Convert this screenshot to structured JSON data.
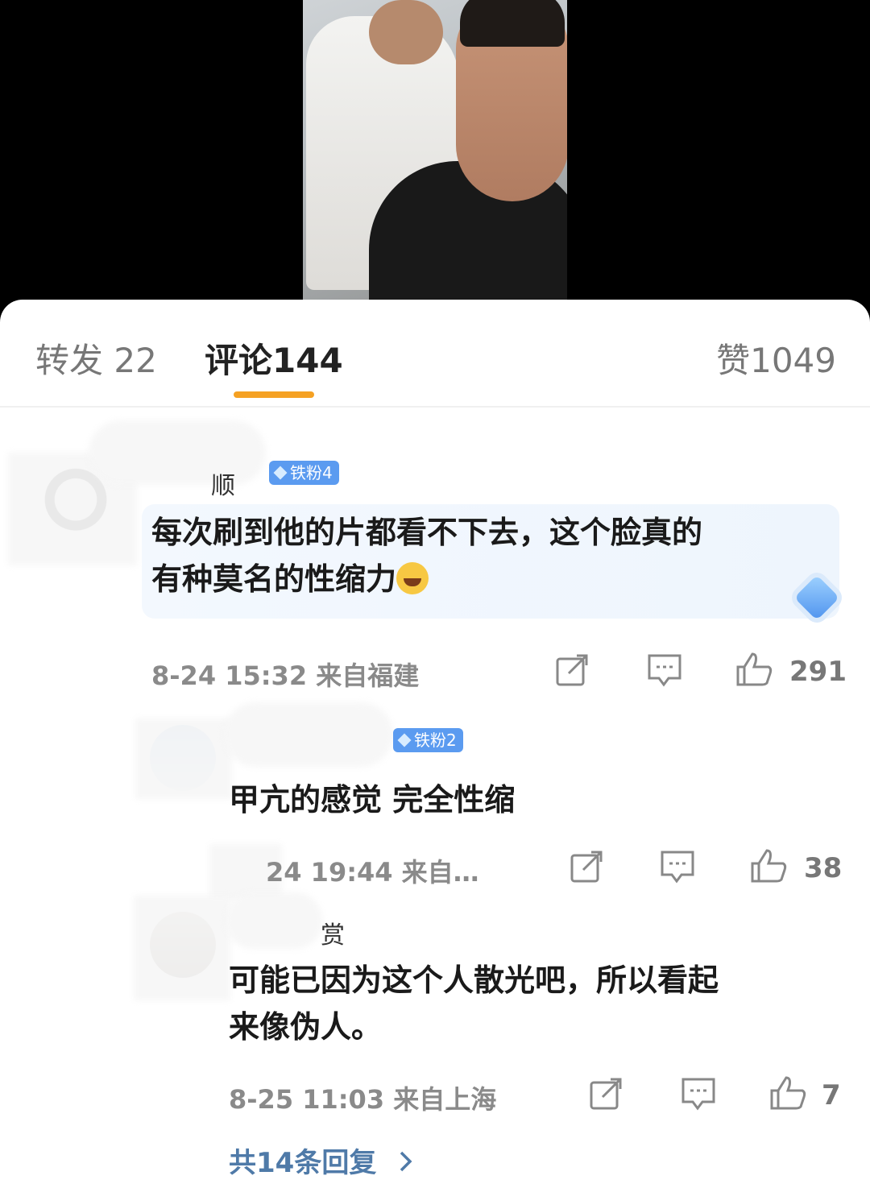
{
  "tabs": {
    "repost": "转发 22",
    "comments": "评论144",
    "likes": "赞1049"
  },
  "comment": {
    "badge": "铁粉4",
    "username_partial": "顺",
    "text_line1": "每次刷到他的片都看不下去，这个脸真的",
    "text_line2": "有种莫名的性缩力",
    "time": "8-24 15:32",
    "location": "来自福建",
    "likes": "291"
  },
  "replies": [
    {
      "badge": "铁粉2",
      "text": "甲亢的感觉  完全性缩",
      "time": "24 19:44",
      "location": "来自…",
      "likes": "38"
    },
    {
      "username_partial": "赏",
      "text_line1": "可能已因为这个人散光吧，所以看起",
      "text_line2": "来像伪人。",
      "time": "8-25 11:03",
      "location": "来自上海",
      "likes": "7"
    }
  ],
  "more_replies": "共14条回复",
  "icons": [
    "share-icon",
    "comment-icon",
    "like-icon",
    "chevron-right-icon",
    "laughing-emoji-icon",
    "diamond-icon"
  ],
  "colors": {
    "accent": "#f5a123",
    "badge": "#5b9bf0",
    "link": "#4f7aa8"
  }
}
